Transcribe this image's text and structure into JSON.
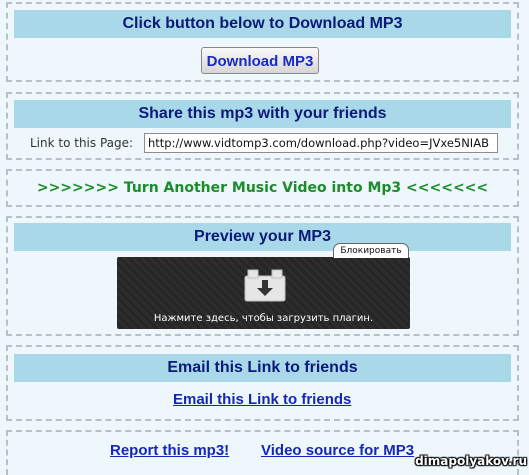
{
  "download": {
    "header": "Click button below to Download MP3",
    "button_label": "Download MP3"
  },
  "share": {
    "header": "Share this mp3 with your friends",
    "link_label": "Link to this Page:",
    "link_value": "http://www.vidtomp3.com/download.php?video=JVxe5NIAB"
  },
  "turn_another": {
    "label": ">>>>>>> Turn Another Music Video into Mp3 <<<<<<<"
  },
  "preview": {
    "header": "Preview your MP3",
    "block_label": "Блокировать",
    "plugin_message": "Нажмите здесь, чтобы загрузить плагин.",
    "plugin_icon": "download-plugin-icon"
  },
  "email": {
    "header": "Email this Link to friends",
    "link_label": "Email this Link to friends"
  },
  "footer": {
    "report_label": "Report this mp3!",
    "source_label": "Video source for MP3"
  },
  "watermark": "dimapolyakov.ru",
  "colors": {
    "header_bg": "#a9d9e8",
    "header_text": "#0b1a7a",
    "link_blue": "#1427b8",
    "green_link": "#1c8c2a",
    "page_bg": "#eef8fc"
  }
}
